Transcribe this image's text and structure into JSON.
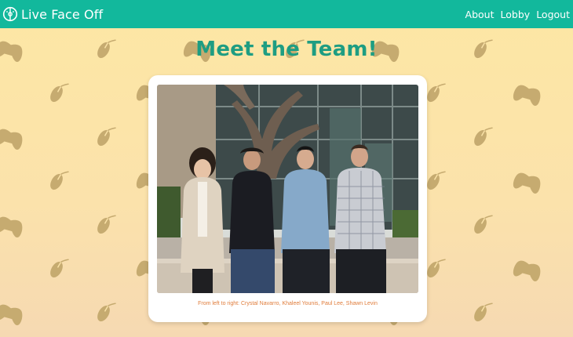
{
  "navbar": {
    "brand": "Live Face Off",
    "links": [
      "About",
      "Lobby",
      "Logout"
    ]
  },
  "page": {
    "title": "Meet the Team!"
  },
  "team_card": {
    "caption": "From left to right: Crystal Navarro, Khaleel Younis, Paul Lee, Shawn Levin"
  },
  "colors": {
    "navbar": "#12b89c",
    "title": "#1e9d82",
    "caption": "#e07c3a",
    "pattern_icon": "#c6ab70"
  },
  "icons": {
    "brand": "face-off-logo-icon",
    "pattern": [
      "gamepad-icon",
      "mouse-icon"
    ]
  }
}
